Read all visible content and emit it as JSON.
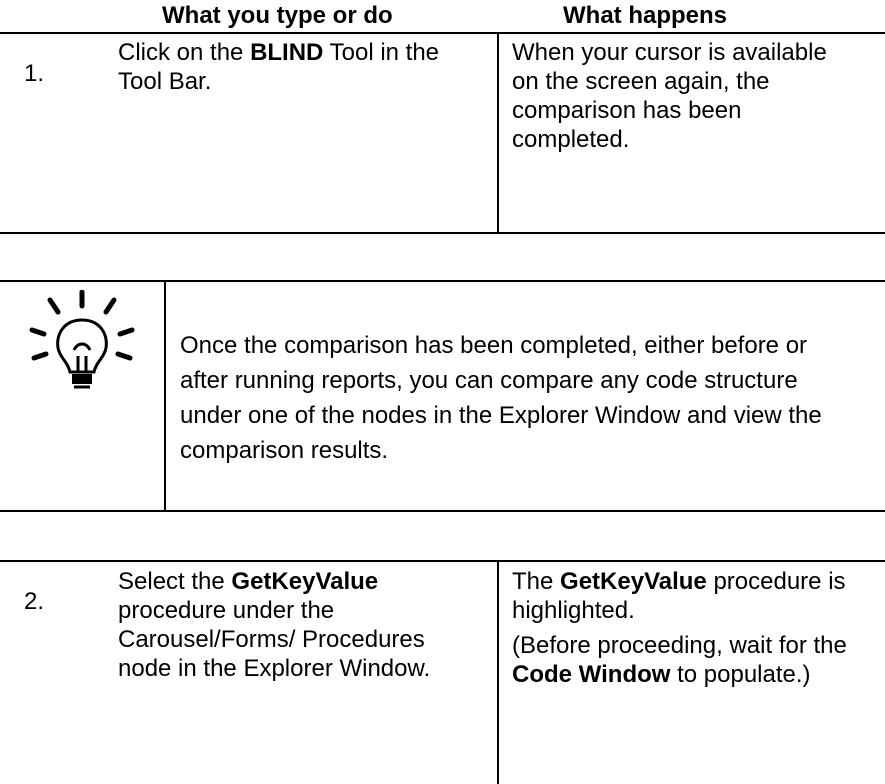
{
  "table_header": {
    "col_action": "What you type or do",
    "col_result": "What happens"
  },
  "step1": {
    "number": "1.",
    "action_pre": "Click on the ",
    "action_bold": "BLIND",
    "action_post": " Tool in the Tool Bar.",
    "result": "When your cursor is available on the screen again, the comparison has been completed."
  },
  "tip": {
    "icon": "lightbulb-icon",
    "text": "Once the comparison has been completed, either before or after running reports, you can compare any code structure under one of the nodes in the Explorer Window and view the comparison results."
  },
  "step2": {
    "number": "2.",
    "action_pre": "Select the ",
    "action_bold": "GetKeyValue",
    "action_post": " procedure under the Carousel/Forms/ Procedures node in the Explorer Window.",
    "result1_pre": "The ",
    "result1_bold": "GetKeyValue",
    "result1_post": " procedure is highlighted.",
    "result2_pre": "(Before proceeding, wait for the ",
    "result2_bold": "Code Window",
    "result2_post": " to populate.)"
  }
}
